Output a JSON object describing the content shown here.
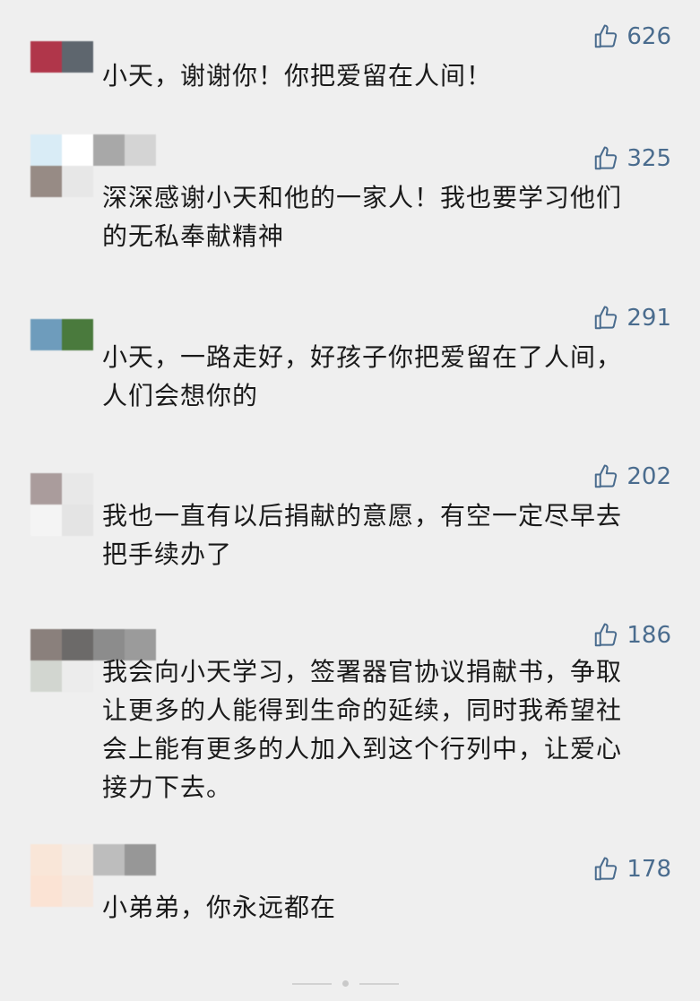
{
  "comments": [
    {
      "likes": "626",
      "lines": [
        "小天，谢谢你！你把爱留在人间！"
      ]
    },
    {
      "likes": "325",
      "lines": [
        "深深感谢小天和他的一家人！我也要学习他们",
        "的无私奉献精神"
      ]
    },
    {
      "likes": "291",
      "lines": [
        "小天，一路走好，好孩子你把爱留在了人间，",
        "人们会想你的"
      ]
    },
    {
      "likes": "202",
      "lines": [
        "我也一直有以后捐献的意愿，有空一定尽早去",
        "把手续办了"
      ]
    },
    {
      "likes": "186",
      "lines": [
        "我会向小天学习，签署器官协议捐献书，争取",
        "让更多的人能得到生命的延续，同时我希望社",
        "会上能有更多的人加入到这个行列中，让爱心",
        "接力下去。"
      ]
    },
    {
      "likes": "178",
      "lines": [
        "小弟弟，你永远都在"
      ]
    }
  ],
  "theme": {
    "background": "#efefef",
    "text_color": "#1a1a1a",
    "like_color": "#4a6c8e"
  },
  "icons": {
    "like": "thumbs-up-icon",
    "avatar": "pixelated-avatar"
  }
}
